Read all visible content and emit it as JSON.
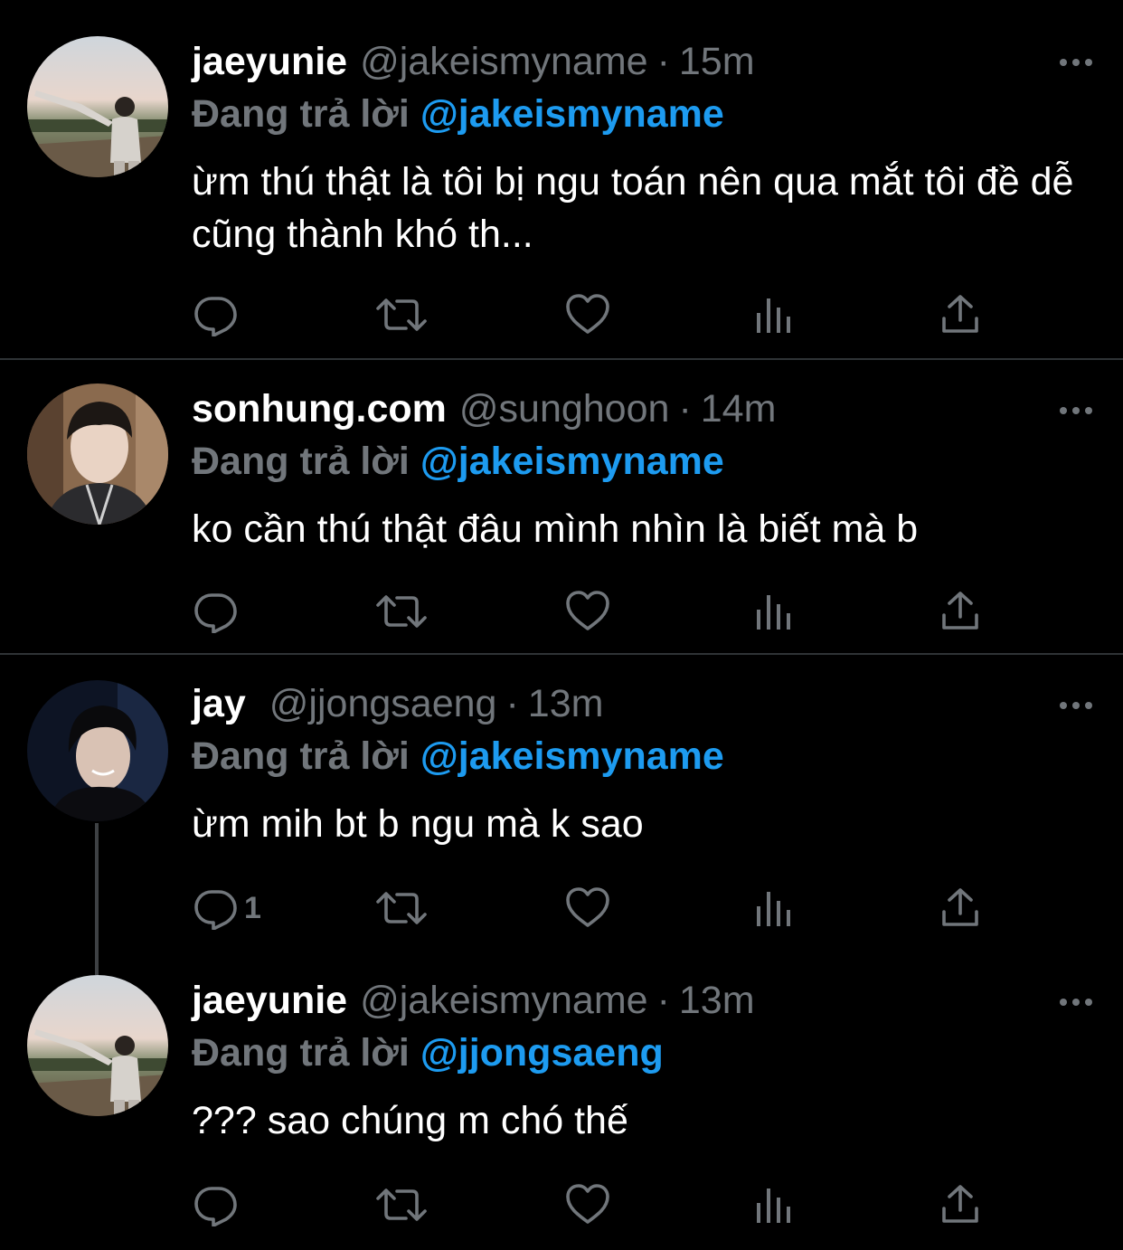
{
  "theme": {
    "background": "#000000",
    "text": "#ffffff",
    "muted": "#71767b",
    "accent": "#1d9bf0",
    "divider": "#2f3336"
  },
  "tweets": [
    {
      "display_name": "jaeyunie",
      "handle": "@jakeismyname",
      "separator": "·",
      "time": "15m",
      "reply_prefix": "Đang trả lời",
      "reply_to": "@jakeismyname",
      "text": "ừm thú thật là tôi bị ngu toán nên qua mắt tôi đề dễ cũng thành khó th...",
      "reply_count": ""
    },
    {
      "display_name": "sonhung.com",
      "handle": "@sunghoon",
      "separator": "·",
      "time": "14m",
      "reply_prefix": "Đang trả lời",
      "reply_to": "@jakeismyname",
      "text": "ko cần thú thật đâu mình nhìn là biết mà b",
      "reply_count": ""
    },
    {
      "display_name": "jay",
      "handle": "@jjongsaeng",
      "separator": "·",
      "time": "13m",
      "reply_prefix": "Đang trả lời",
      "reply_to": "@jakeismyname",
      "text": "ừm mih bt b ngu mà k sao",
      "reply_count": "1"
    },
    {
      "display_name": "jaeyunie",
      "handle": "@jakeismyname",
      "separator": "·",
      "time": "13m",
      "reply_prefix": "Đang trả lời",
      "reply_to": "@jjongsaeng",
      "text": "??? sao chúng m chó thế",
      "reply_count": ""
    }
  ],
  "icons": {
    "reply": "reply-bubble-icon",
    "retweet": "retweet-icon",
    "like": "heart-icon",
    "views": "bar-chart-icon",
    "share": "share-upload-icon",
    "more": "more-dots-icon"
  }
}
